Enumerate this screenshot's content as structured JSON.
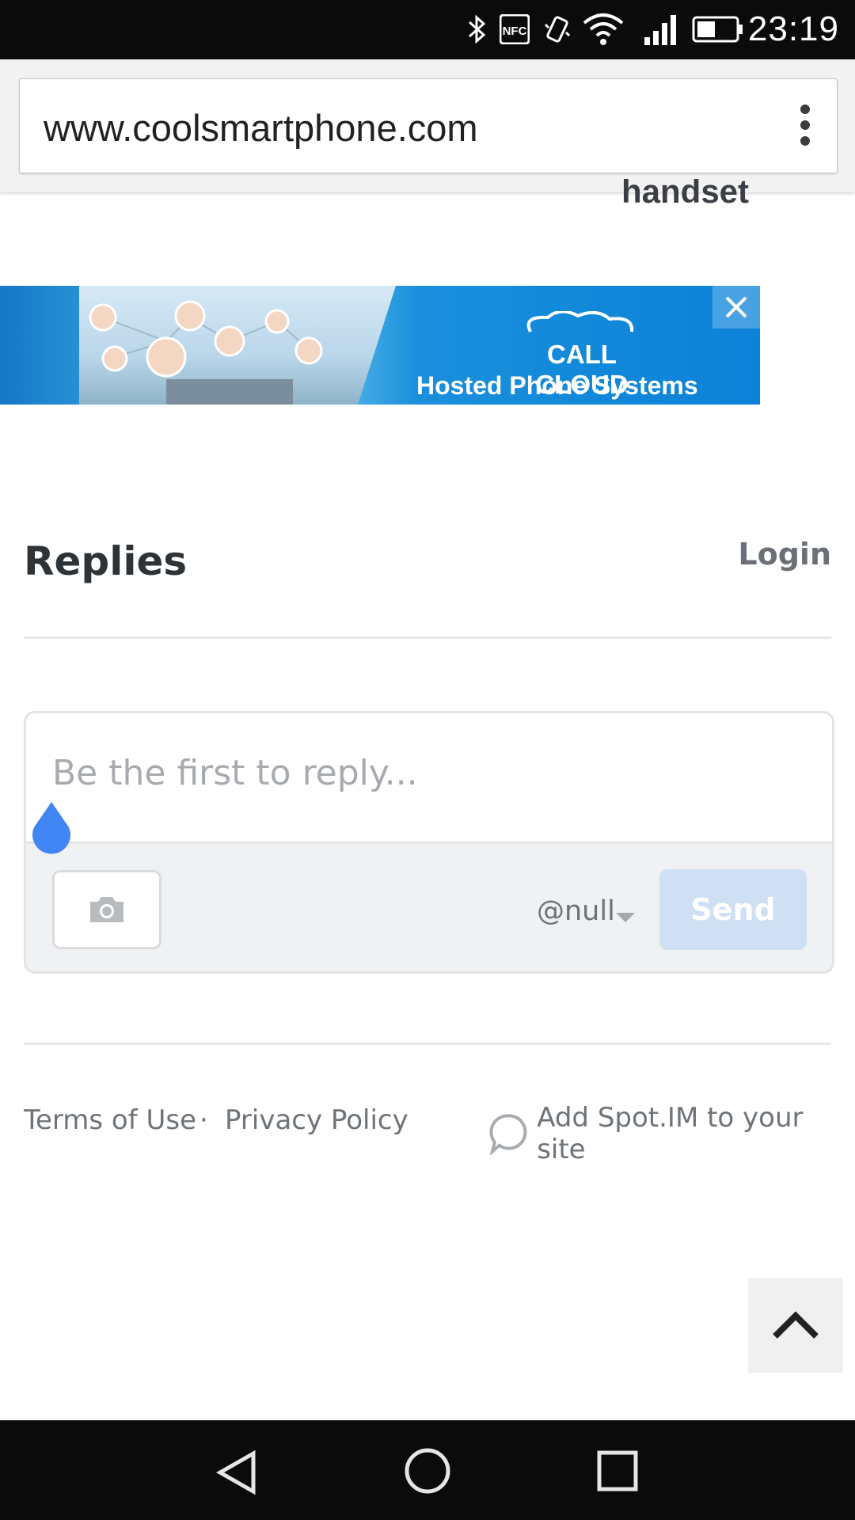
{
  "status_bar": {
    "time": "23:19",
    "icons": [
      "bluetooth-icon",
      "nfc-icon",
      "vibrate-icon",
      "wifi-icon",
      "signal-icon",
      "battery-icon"
    ],
    "nfc_label": "NFC"
  },
  "browser": {
    "url": "www.coolsmartphone.com",
    "menu_icon": "more-vert-icon"
  },
  "page": {
    "partial_heading": "handset",
    "ad": {
      "brand": "CALL CLOUD",
      "tagline": "Hosted Phone Systems",
      "close_icon": "close-icon"
    },
    "replies": {
      "title": "Replies",
      "login": "Login",
      "composer": {
        "placeholder": "Be the first to reply...",
        "user": "@null",
        "send_label": "Send"
      }
    },
    "footer": {
      "terms": "Terms of Use",
      "separator": "·",
      "privacy": "Privacy Policy",
      "spot": "Add Spot.IM to your site"
    }
  },
  "colors": {
    "send_disabled": "#cfdff4",
    "text_dark": "#2e3338",
    "muted": "#6e7379",
    "status_bg": "#0b0b0b"
  }
}
